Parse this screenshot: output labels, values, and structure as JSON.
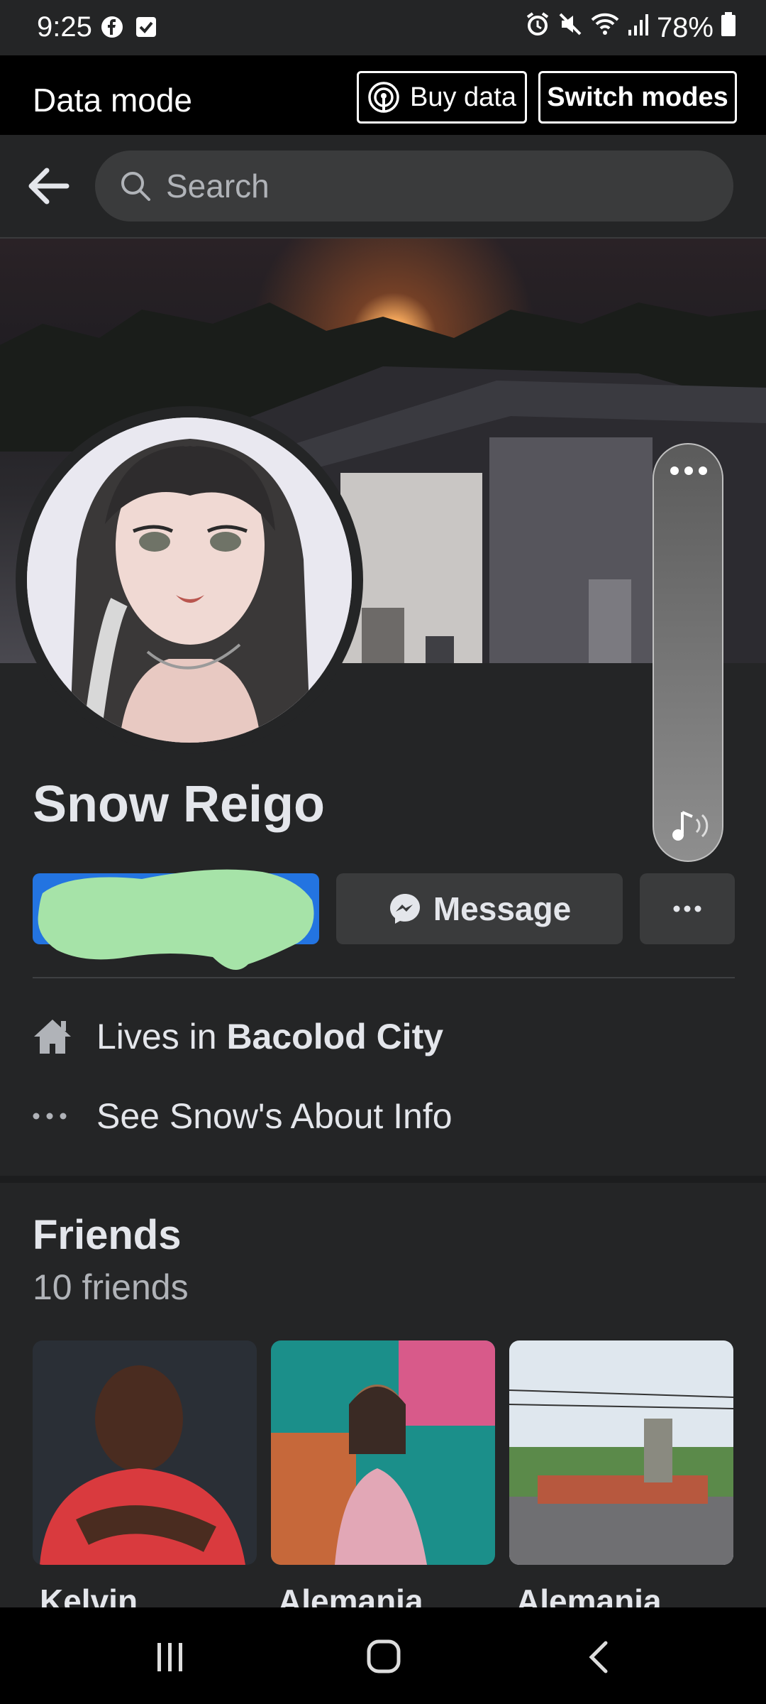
{
  "status_bar": {
    "time": "9:25",
    "battery": "78%",
    "left_icons": [
      "facebook-icon",
      "checkbox-notification-icon"
    ],
    "right_icons": [
      "alarm-icon",
      "mute-icon",
      "wifi-icon",
      "signal-icon",
      "battery-icon"
    ]
  },
  "data_mode": {
    "title": "Data mode",
    "buy_data": "Buy data",
    "switch_modes": "Switch modes"
  },
  "search": {
    "placeholder": "Search"
  },
  "profile": {
    "name": "Snow Reigo",
    "message_label": "Message",
    "lives_prefix": "Lives in ",
    "city": "Bacolod City",
    "about_link": "See Snow's About Info"
  },
  "friends": {
    "title": "Friends",
    "count": "10 friends",
    "items": [
      {
        "name": "Kelvin"
      },
      {
        "name": "Alemania"
      },
      {
        "name": "Alemania"
      }
    ]
  },
  "colors": {
    "background": "#242526",
    "accent": "#2374e1",
    "secondary_button": "#3a3b3c",
    "redaction": "#a6e3a8"
  }
}
